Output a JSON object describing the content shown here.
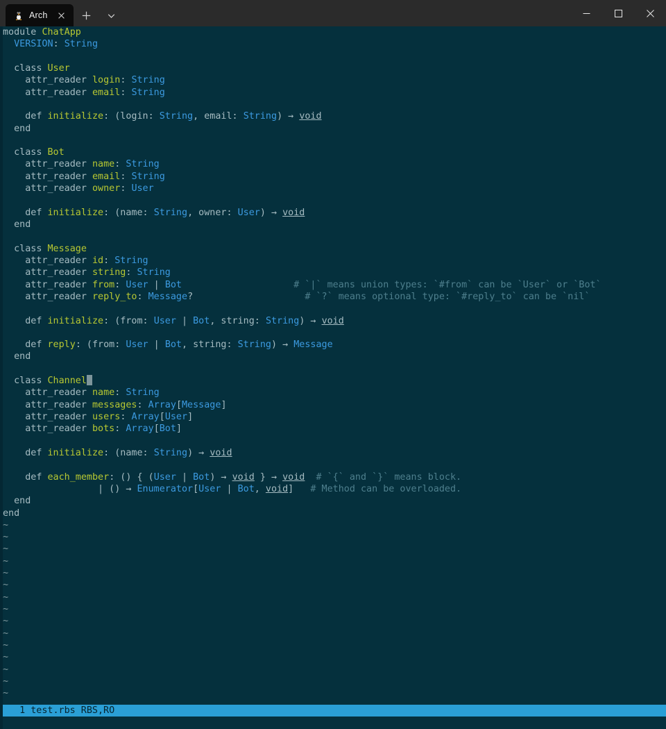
{
  "window": {
    "tab": {
      "title": "Arch",
      "icon": "tux-penguin-icon",
      "close_label": "✕"
    },
    "new_tab_label": "+",
    "tab_dropdown_label": "⌄",
    "controls": {
      "minimize_label": "—",
      "maximize_label": "☐",
      "close_label": "✕"
    },
    "colors": {
      "titlebar_bg": "#2b2b2b",
      "tab_bg": "#0c0c0c",
      "terminal_bg": "#05303d",
      "statusline_bg": "#2a9fd6",
      "statusline_fg": "#06232d",
      "type_color": "#3c9ae0",
      "const_color": "#b8c832",
      "comment_color": "#4e7f8d",
      "text_color": "#a6bcc2"
    }
  },
  "editor": {
    "filler_char": "~",
    "filler_count": 16,
    "cursor_line_index": 28,
    "lines": [
      {
        "segments": [
          {
            "t": "module ",
            "c": "c-kw"
          },
          {
            "t": "ChatApp",
            "c": "c-const"
          }
        ]
      },
      {
        "segments": [
          {
            "t": "  ",
            "c": "c-plain"
          },
          {
            "t": "VERSION",
            "c": "c-type"
          },
          {
            "t": ": ",
            "c": "c-plain"
          },
          {
            "t": "String",
            "c": "c-type"
          }
        ]
      },
      {
        "segments": []
      },
      {
        "segments": [
          {
            "t": "  class ",
            "c": "c-kw"
          },
          {
            "t": "User",
            "c": "c-const"
          }
        ]
      },
      {
        "segments": [
          {
            "t": "    attr_reader ",
            "c": "c-plain"
          },
          {
            "t": "login",
            "c": "c-ident"
          },
          {
            "t": ": ",
            "c": "c-plain"
          },
          {
            "t": "String",
            "c": "c-type"
          }
        ]
      },
      {
        "segments": [
          {
            "t": "    attr_reader ",
            "c": "c-plain"
          },
          {
            "t": "email",
            "c": "c-ident"
          },
          {
            "t": ": ",
            "c": "c-plain"
          },
          {
            "t": "String",
            "c": "c-type"
          }
        ]
      },
      {
        "segments": []
      },
      {
        "segments": [
          {
            "t": "    def ",
            "c": "c-plain"
          },
          {
            "t": "initialize",
            "c": "c-ident"
          },
          {
            "t": ": (login: ",
            "c": "c-plain"
          },
          {
            "t": "String",
            "c": "c-type"
          },
          {
            "t": ", email: ",
            "c": "c-plain"
          },
          {
            "t": "String",
            "c": "c-type"
          },
          {
            "t": ") → ",
            "c": "c-plain"
          },
          {
            "t": "void",
            "c": "c-voidu"
          }
        ]
      },
      {
        "segments": [
          {
            "t": "  end",
            "c": "c-plain"
          }
        ]
      },
      {
        "segments": []
      },
      {
        "segments": [
          {
            "t": "  class ",
            "c": "c-kw"
          },
          {
            "t": "Bot",
            "c": "c-const"
          }
        ]
      },
      {
        "segments": [
          {
            "t": "    attr_reader ",
            "c": "c-plain"
          },
          {
            "t": "name",
            "c": "c-ident"
          },
          {
            "t": ": ",
            "c": "c-plain"
          },
          {
            "t": "String",
            "c": "c-type"
          }
        ]
      },
      {
        "segments": [
          {
            "t": "    attr_reader ",
            "c": "c-plain"
          },
          {
            "t": "email",
            "c": "c-ident"
          },
          {
            "t": ": ",
            "c": "c-plain"
          },
          {
            "t": "String",
            "c": "c-type"
          }
        ]
      },
      {
        "segments": [
          {
            "t": "    attr_reader ",
            "c": "c-plain"
          },
          {
            "t": "owner",
            "c": "c-ident"
          },
          {
            "t": ": ",
            "c": "c-plain"
          },
          {
            "t": "User",
            "c": "c-type"
          }
        ]
      },
      {
        "segments": []
      },
      {
        "segments": [
          {
            "t": "    def ",
            "c": "c-plain"
          },
          {
            "t": "initialize",
            "c": "c-ident"
          },
          {
            "t": ": (name: ",
            "c": "c-plain"
          },
          {
            "t": "String",
            "c": "c-type"
          },
          {
            "t": ", owner: ",
            "c": "c-plain"
          },
          {
            "t": "User",
            "c": "c-type"
          },
          {
            "t": ") → ",
            "c": "c-plain"
          },
          {
            "t": "void",
            "c": "c-voidu"
          }
        ]
      },
      {
        "segments": [
          {
            "t": "  end",
            "c": "c-plain"
          }
        ]
      },
      {
        "segments": []
      },
      {
        "segments": [
          {
            "t": "  class ",
            "c": "c-kw"
          },
          {
            "t": "Message",
            "c": "c-const"
          }
        ]
      },
      {
        "segments": [
          {
            "t": "    attr_reader ",
            "c": "c-plain"
          },
          {
            "t": "id",
            "c": "c-ident"
          },
          {
            "t": ": ",
            "c": "c-plain"
          },
          {
            "t": "String",
            "c": "c-type"
          }
        ]
      },
      {
        "segments": [
          {
            "t": "    attr_reader ",
            "c": "c-plain"
          },
          {
            "t": "string",
            "c": "c-ident"
          },
          {
            "t": ": ",
            "c": "c-plain"
          },
          {
            "t": "String",
            "c": "c-type"
          }
        ]
      },
      {
        "segments": [
          {
            "t": "    attr_reader ",
            "c": "c-plain"
          },
          {
            "t": "from",
            "c": "c-ident"
          },
          {
            "t": ": ",
            "c": "c-plain"
          },
          {
            "t": "User",
            "c": "c-type"
          },
          {
            "t": " | ",
            "c": "c-plain"
          },
          {
            "t": "Bot",
            "c": "c-type"
          },
          {
            "t": "                    ",
            "c": "c-plain"
          },
          {
            "t": "# `|` means union types: `#from` can be `User` or `Bot`",
            "c": "c-comment"
          }
        ]
      },
      {
        "segments": [
          {
            "t": "    attr_reader ",
            "c": "c-plain"
          },
          {
            "t": "reply_to",
            "c": "c-ident"
          },
          {
            "t": ": ",
            "c": "c-plain"
          },
          {
            "t": "Message",
            "c": "c-type"
          },
          {
            "t": "?",
            "c": "c-plain"
          },
          {
            "t": "                    ",
            "c": "c-plain"
          },
          {
            "t": "# `?` means optional type: `#reply_to` can be `nil`",
            "c": "c-comment"
          }
        ]
      },
      {
        "segments": []
      },
      {
        "segments": [
          {
            "t": "    def ",
            "c": "c-plain"
          },
          {
            "t": "initialize",
            "c": "c-ident"
          },
          {
            "t": ": (from: ",
            "c": "c-plain"
          },
          {
            "t": "User",
            "c": "c-type"
          },
          {
            "t": " | ",
            "c": "c-plain"
          },
          {
            "t": "Bot",
            "c": "c-type"
          },
          {
            "t": ", string: ",
            "c": "c-plain"
          },
          {
            "t": "String",
            "c": "c-type"
          },
          {
            "t": ") → ",
            "c": "c-plain"
          },
          {
            "t": "void",
            "c": "c-voidu"
          }
        ]
      },
      {
        "segments": []
      },
      {
        "segments": [
          {
            "t": "    def ",
            "c": "c-plain"
          },
          {
            "t": "reply",
            "c": "c-ident"
          },
          {
            "t": ": (from: ",
            "c": "c-plain"
          },
          {
            "t": "User",
            "c": "c-type"
          },
          {
            "t": " | ",
            "c": "c-plain"
          },
          {
            "t": "Bot",
            "c": "c-type"
          },
          {
            "t": ", string: ",
            "c": "c-plain"
          },
          {
            "t": "String",
            "c": "c-type"
          },
          {
            "t": ") → ",
            "c": "c-plain"
          },
          {
            "t": "Message",
            "c": "c-type"
          }
        ]
      },
      {
        "segments": [
          {
            "t": "  end",
            "c": "c-plain"
          }
        ]
      },
      {
        "segments": []
      },
      {
        "segments": [
          {
            "t": "  class ",
            "c": "c-kw"
          },
          {
            "t": "Channel",
            "c": "c-const"
          }
        ],
        "cursor_after": true
      },
      {
        "segments": [
          {
            "t": "    attr_reader ",
            "c": "c-plain"
          },
          {
            "t": "name",
            "c": "c-ident"
          },
          {
            "t": ": ",
            "c": "c-plain"
          },
          {
            "t": "String",
            "c": "c-type"
          }
        ]
      },
      {
        "segments": [
          {
            "t": "    attr_reader ",
            "c": "c-plain"
          },
          {
            "t": "messages",
            "c": "c-ident"
          },
          {
            "t": ": ",
            "c": "c-plain"
          },
          {
            "t": "Array",
            "c": "c-type"
          },
          {
            "t": "[",
            "c": "c-plain"
          },
          {
            "t": "Message",
            "c": "c-type"
          },
          {
            "t": "]",
            "c": "c-plain"
          }
        ]
      },
      {
        "segments": [
          {
            "t": "    attr_reader ",
            "c": "c-plain"
          },
          {
            "t": "users",
            "c": "c-ident"
          },
          {
            "t": ": ",
            "c": "c-plain"
          },
          {
            "t": "Array",
            "c": "c-type"
          },
          {
            "t": "[",
            "c": "c-plain"
          },
          {
            "t": "User",
            "c": "c-type"
          },
          {
            "t": "]",
            "c": "c-plain"
          }
        ]
      },
      {
        "segments": [
          {
            "t": "    attr_reader ",
            "c": "c-plain"
          },
          {
            "t": "bots",
            "c": "c-ident"
          },
          {
            "t": ": ",
            "c": "c-plain"
          },
          {
            "t": "Array",
            "c": "c-type"
          },
          {
            "t": "[",
            "c": "c-plain"
          },
          {
            "t": "Bot",
            "c": "c-type"
          },
          {
            "t": "]",
            "c": "c-plain"
          }
        ]
      },
      {
        "segments": []
      },
      {
        "segments": [
          {
            "t": "    def ",
            "c": "c-plain"
          },
          {
            "t": "initialize",
            "c": "c-ident"
          },
          {
            "t": ": (name: ",
            "c": "c-plain"
          },
          {
            "t": "String",
            "c": "c-type"
          },
          {
            "t": ") → ",
            "c": "c-plain"
          },
          {
            "t": "void",
            "c": "c-voidu"
          }
        ]
      },
      {
        "segments": []
      },
      {
        "segments": [
          {
            "t": "    def ",
            "c": "c-plain"
          },
          {
            "t": "each_member",
            "c": "c-ident"
          },
          {
            "t": ": () { (",
            "c": "c-plain"
          },
          {
            "t": "User",
            "c": "c-type"
          },
          {
            "t": " | ",
            "c": "c-plain"
          },
          {
            "t": "Bot",
            "c": "c-type"
          },
          {
            "t": ") → ",
            "c": "c-plain"
          },
          {
            "t": "void",
            "c": "c-voidu"
          },
          {
            "t": " } → ",
            "c": "c-plain"
          },
          {
            "t": "void",
            "c": "c-voidu"
          },
          {
            "t": "  ",
            "c": "c-plain"
          },
          {
            "t": "# `{` and `}` means block.",
            "c": "c-comment"
          }
        ]
      },
      {
        "segments": [
          {
            "t": "                 | () → ",
            "c": "c-plain"
          },
          {
            "t": "Enumerator",
            "c": "c-type"
          },
          {
            "t": "[",
            "c": "c-plain"
          },
          {
            "t": "User",
            "c": "c-type"
          },
          {
            "t": " | ",
            "c": "c-plain"
          },
          {
            "t": "Bot",
            "c": "c-type"
          },
          {
            "t": ", ",
            "c": "c-plain"
          },
          {
            "t": "void",
            "c": "c-voidu"
          },
          {
            "t": "]",
            "c": "c-plain"
          },
          {
            "t": "   ",
            "c": "c-plain"
          },
          {
            "t": "# Method can be overloaded.",
            "c": "c-comment"
          }
        ]
      },
      {
        "segments": [
          {
            "t": "  end",
            "c": "c-plain"
          }
        ]
      },
      {
        "segments": [
          {
            "t": "end",
            "c": "c-plain"
          }
        ]
      }
    ]
  },
  "statusline": {
    "text": "  1 test.rbs RBS,RO"
  },
  "cmdline": {
    "text": ""
  }
}
